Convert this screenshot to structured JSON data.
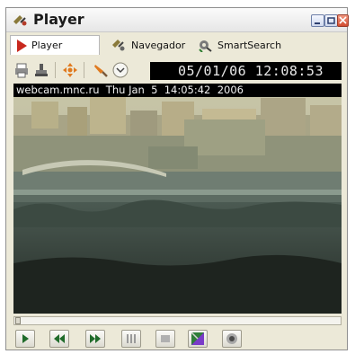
{
  "window": {
    "title": "Player"
  },
  "tabs": [
    {
      "label": "Player",
      "icon": "play-icon"
    },
    {
      "label": "Navegador",
      "icon": "satellite-icon"
    },
    {
      "label": "SmartSearch",
      "icon": "search-gear-icon"
    }
  ],
  "toolbar": {
    "icons": [
      "print-icon",
      "stamp-icon",
      "move-icon",
      "brush-icon",
      "dropdown-icon"
    ],
    "clock": "05/01/06  12:08:53"
  },
  "video": {
    "overlay": "webcam.mnc.ru  Thu Jan  5  14:05:42  2006"
  },
  "controls": [
    "play-button",
    "rewind-button",
    "fast-forward-button",
    "step-back-button",
    "frame-button",
    "color-button",
    "snapshot-button"
  ],
  "colors": {
    "accent_red": "#c8281e",
    "panel": "#ece9d8",
    "clock_bg": "#000000"
  }
}
